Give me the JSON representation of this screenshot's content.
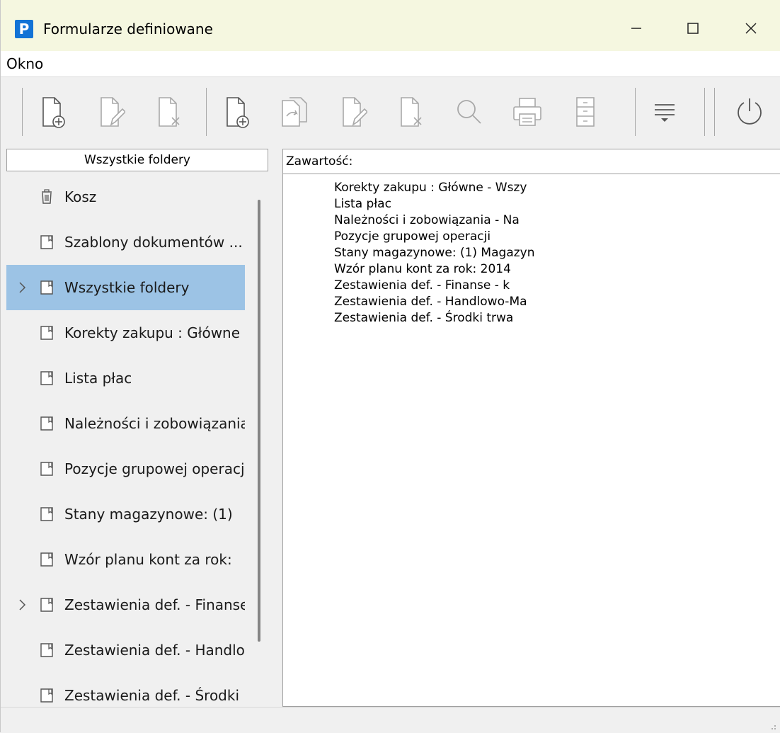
{
  "window": {
    "title": "Formularze definiowane",
    "app_icon_letter": "P"
  },
  "menu": {
    "items": [
      "Okno"
    ]
  },
  "toolbar": {
    "buttons": [
      "new-document-icon",
      "edit-document-icon",
      "delete-document-icon",
      "new-document-icon",
      "copy-document-icon",
      "edit-document-icon",
      "delete-document-icon",
      "search-icon",
      "print-icon",
      "cabinet-icon",
      "filter-list-icon",
      "power-icon"
    ]
  },
  "left_panel": {
    "header": "Wszystkie foldery",
    "items": [
      {
        "label": "Kosz",
        "icon": "trash-icon",
        "expandable": false,
        "selected": false
      },
      {
        "label": "Szablony dokumentów ...",
        "icon": "folder-icon",
        "expandable": false,
        "selected": false
      },
      {
        "label": "Wszystkie foldery",
        "icon": "folder-icon",
        "expandable": true,
        "selected": true
      },
      {
        "label": "Korekty zakupu : Główne",
        "icon": "folder-icon",
        "expandable": false,
        "selected": false
      },
      {
        "label": "Lista płac",
        "icon": "folder-icon",
        "expandable": false,
        "selected": false
      },
      {
        "label": "Należności i zobowiązania",
        "icon": "folder-icon",
        "expandable": false,
        "selected": false
      },
      {
        "label": "Pozycje grupowej operacji",
        "icon": "folder-icon",
        "expandable": false,
        "selected": false
      },
      {
        "label": "Stany magazynowe: (1)",
        "icon": "folder-icon",
        "expandable": false,
        "selected": false
      },
      {
        "label": "Wzór planu kont za rok:",
        "icon": "folder-icon",
        "expandable": false,
        "selected": false
      },
      {
        "label": "Zestawienia def. - Finanse",
        "icon": "folder-icon",
        "expandable": true,
        "selected": false
      },
      {
        "label": "Zestawienia def. - Handlowo",
        "icon": "folder-icon",
        "expandable": false,
        "selected": false
      },
      {
        "label": "Zestawienia def. - Środki",
        "icon": "folder-icon",
        "expandable": false,
        "selected": false
      }
    ]
  },
  "right_panel": {
    "header": "Zawartość:",
    "items": [
      "Korekty zakupu : Główne - Wszy",
      "Lista płac",
      "Należności i zobowiązania - Na",
      "Pozycje grupowej operacji",
      "Stany magazynowe: (1) Magazyn",
      "Wzór planu kont za rok: 2014",
      "Zestawienia def. - Finanse - k",
      "Zestawienia def. - Handlowo-Ma",
      "Zestawienia def. - Środki trwa"
    ]
  }
}
